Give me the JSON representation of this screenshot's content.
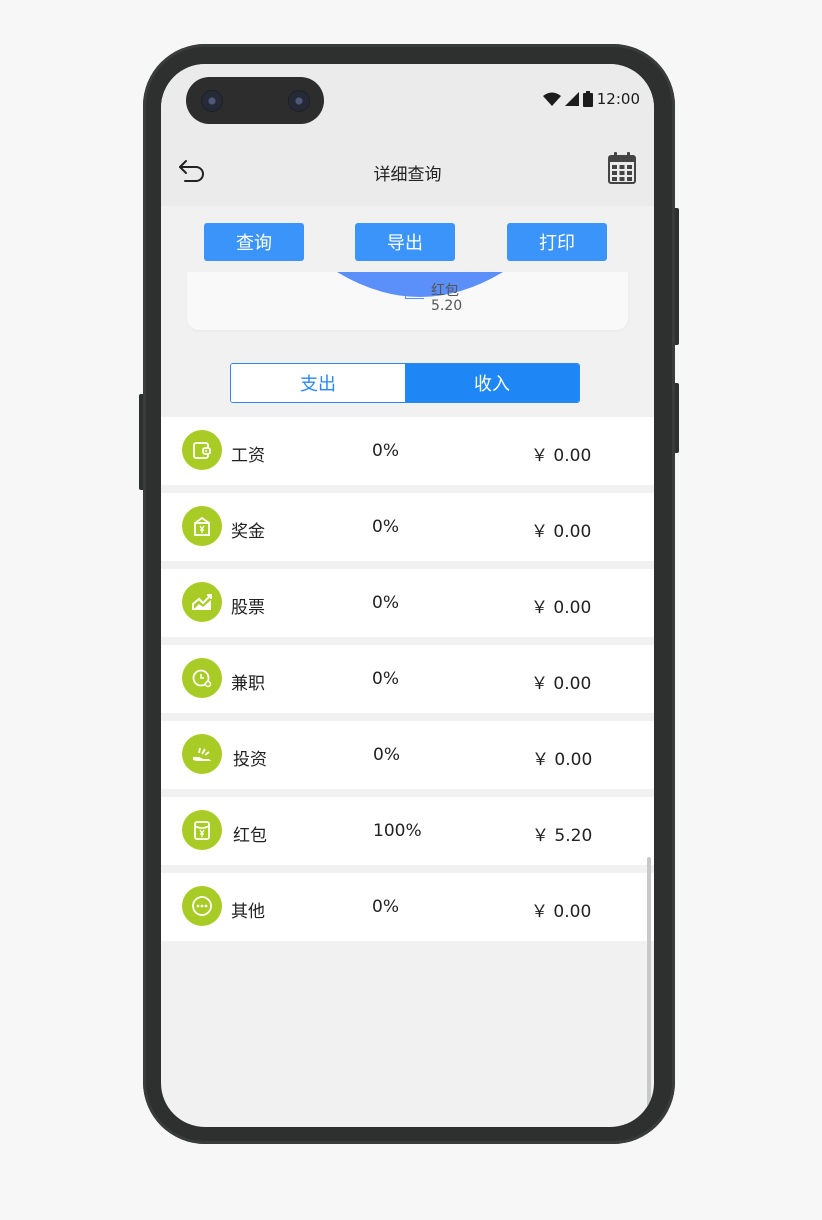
{
  "status_bar": {
    "time": "12:00"
  },
  "header": {
    "title": "详细查询",
    "back_icon": "back-arrow-icon",
    "calendar_icon": "calendar-icon"
  },
  "toolbar": {
    "query_label": "查询",
    "export_label": "导出",
    "print_label": "打印",
    "accent": "#3a94f9"
  },
  "chart": {
    "label_name": "红包",
    "label_value": "5.20",
    "slice_color": "#5b8ff9"
  },
  "segment": {
    "expense_label": "支出",
    "income_label": "收入",
    "selected": "收入"
  },
  "rows": [
    {
      "name": "工资",
      "percent": "0%",
      "amount": "￥ 0.00",
      "icon": "wallet-icon"
    },
    {
      "name": "奖金",
      "percent": "0%",
      "amount": "￥ 0.00",
      "icon": "bonus-icon"
    },
    {
      "name": "股票",
      "percent": "0%",
      "amount": "￥ 0.00",
      "icon": "stock-chart-icon"
    },
    {
      "name": "兼职",
      "percent": "0%",
      "amount": "￥ 0.00",
      "icon": "part-time-clock-icon"
    },
    {
      "name": "投资",
      "percent": "0%",
      "amount": "￥ 0.00",
      "icon": "investment-hand-icon"
    },
    {
      "name": "红包",
      "percent": "100%",
      "amount": "￥ 5.20",
      "icon": "red-packet-icon"
    },
    {
      "name": "其他",
      "percent": "0%",
      "amount": "￥ 0.00",
      "icon": "more-icon"
    }
  ],
  "colors": {
    "icon_bg": "#a8cb26",
    "segment_active": "#1f87f5"
  }
}
